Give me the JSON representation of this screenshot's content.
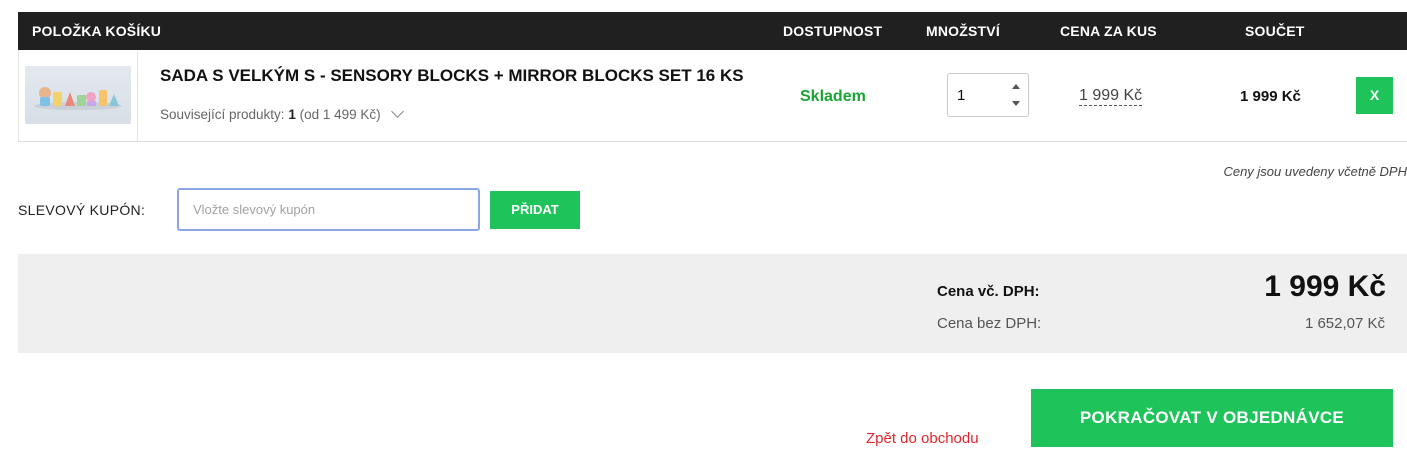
{
  "header": {
    "item": "POLOŽKA KOŠÍKU",
    "availability": "DOSTUPNOST",
    "quantity": "MNOŽSTVÍ",
    "unit_price": "CENA ZA KUS",
    "total": "SOUČET"
  },
  "item": {
    "title": "SADA S VELKÝM S - SENSORY BLOCKS + MIRROR BLOCKS SET 16 KS",
    "related_label": "Související produkty:",
    "related_count": "1",
    "related_from": "(od 1 499 Kč)",
    "availability": "Skladem",
    "quantity": "1",
    "unit_price": "1 999 Kč",
    "total": "1 999 Kč",
    "remove_label": "X"
  },
  "vat_note": "Ceny jsou uvedeny včetně DPH",
  "coupon": {
    "label": "SLEVOVÝ KUPÓN:",
    "placeholder": "Vložte slevový kupón",
    "value": "",
    "button": "PŘIDAT"
  },
  "summary": {
    "with_vat_label": "Cena vč. DPH:",
    "with_vat_value": "1 999 Kč",
    "without_vat_label": "Cena bez DPH:",
    "without_vat_value": "1 652,07 Kč"
  },
  "actions": {
    "back": "Zpět do obchodu",
    "continue": "POKRAČOVAT V OBJEDNÁVCE"
  },
  "colors": {
    "header_bg": "#202020",
    "accent_green": "#1ec45a",
    "stock_green": "#19a533",
    "link_red": "#e0262b",
    "summary_bg": "#efefef"
  },
  "icons": {
    "quantity_increase": "triangle-up-icon",
    "quantity_decrease": "triangle-down-icon",
    "related_toggle": "chevron-down-icon"
  }
}
